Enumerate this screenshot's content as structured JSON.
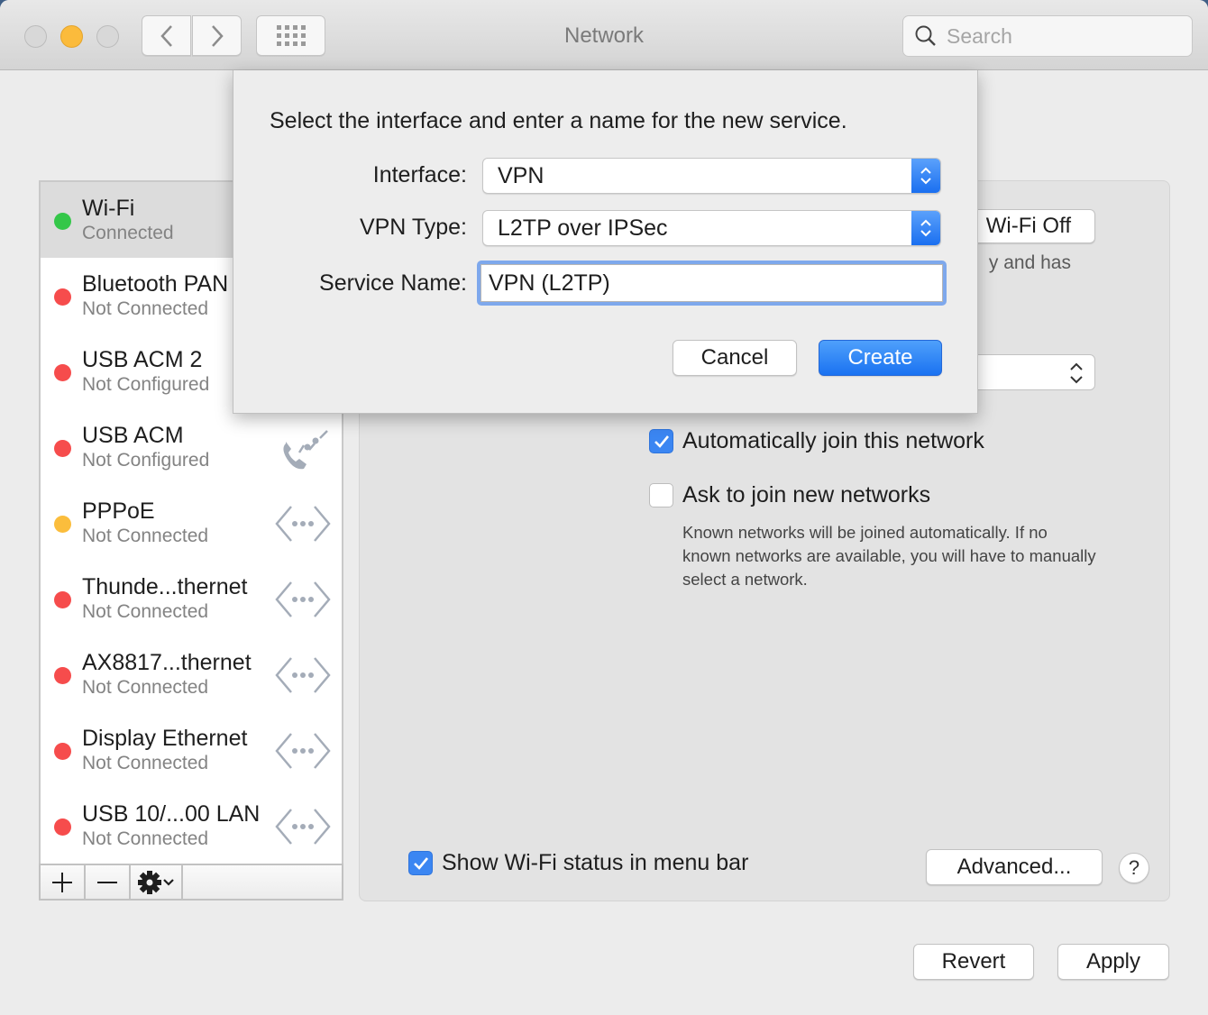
{
  "window": {
    "title": "Network",
    "search_placeholder": "Search",
    "search_value": ""
  },
  "services": [
    {
      "name": "Wi-Fi",
      "status": "Connected",
      "dot_color": "#34c749",
      "icon": "none",
      "selected": true
    },
    {
      "name": "Bluetooth PAN",
      "status": "Not Connected",
      "dot_color": "#f64c4c",
      "icon": "none",
      "selected": false
    },
    {
      "name": "USB ACM 2",
      "status": "Not Configured",
      "dot_color": "#f64c4c",
      "icon": "none",
      "selected": false
    },
    {
      "name": "USB ACM",
      "status": "Not Configured",
      "dot_color": "#f64c4c",
      "icon": "phone-modem-icon",
      "selected": false
    },
    {
      "name": "PPPoE",
      "status": "Not Connected",
      "dot_color": "#fbbd3c",
      "icon": "ethernet-icon",
      "selected": false
    },
    {
      "name": "Thunde...thernet",
      "status": "Not Connected",
      "dot_color": "#f64c4c",
      "icon": "ethernet-icon",
      "selected": false
    },
    {
      "name": "AX8817...thernet",
      "status": "Not Connected",
      "dot_color": "#f64c4c",
      "icon": "ethernet-icon",
      "selected": false
    },
    {
      "name": "Display Ethernet",
      "status": "Not Connected",
      "dot_color": "#f64c4c",
      "icon": "ethernet-icon",
      "selected": false
    },
    {
      "name": "USB 10/...00 LAN",
      "status": "Not Connected",
      "dot_color": "#f64c4c",
      "icon": "ethernet-icon",
      "selected": false
    }
  ],
  "list_toolbar": {
    "add": "+",
    "remove": "—"
  },
  "pane": {
    "wifi_off_label": "Wi-Fi Off",
    "status_fragment": "y and has",
    "auto_join": {
      "label": "Automatically join this network",
      "checked": true
    },
    "ask_join": {
      "label": "Ask to join new networks",
      "checked": false
    },
    "hint": "Known networks will be joined automatically. If no known networks are available, you will have to manually select a network.",
    "show_status": {
      "label": "Show Wi-Fi status in menu bar",
      "checked": true
    },
    "advanced_label": "Advanced...",
    "help_label": "?",
    "revert_label": "Revert",
    "apply_label": "Apply"
  },
  "sheet": {
    "message": "Select the interface and enter a name for the new service.",
    "interface_label": "Interface:",
    "interface_value": "VPN",
    "vpn_type_label": "VPN Type:",
    "vpn_type_value": "L2TP over IPSec",
    "service_name_label": "Service Name:",
    "service_name_value": "VPN (L2TP)",
    "cancel_label": "Cancel",
    "create_label": "Create"
  },
  "colors": {
    "accent": "#1a72f1",
    "connected": "#34c749",
    "not_connected": "#f64c4c",
    "warning": "#fbbd3c"
  }
}
